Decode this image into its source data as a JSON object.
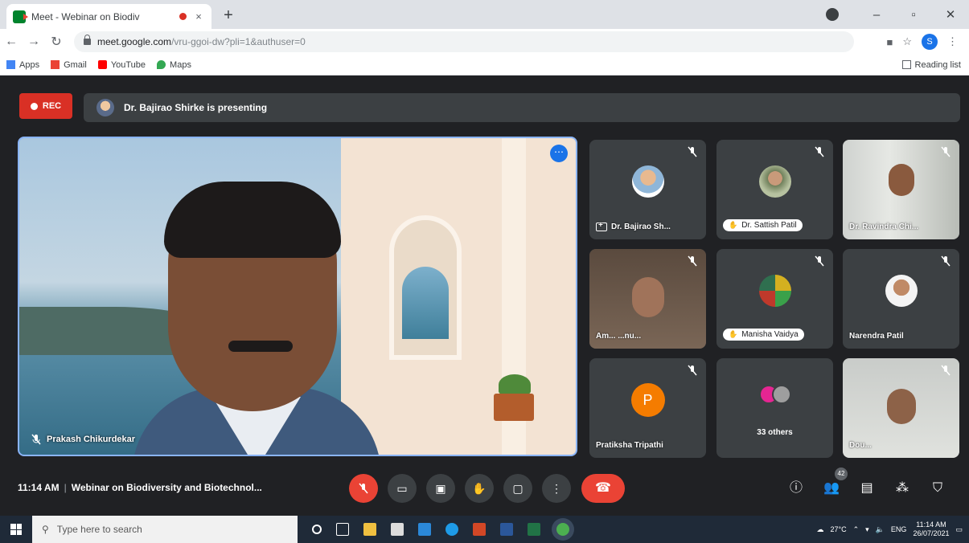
{
  "browser": {
    "tab_title": "Meet - Webinar on Biodiv",
    "tab_close": "×",
    "new_tab": "+",
    "win_minimize": "–",
    "win_maximize": "▫",
    "win_close": "✕",
    "url_host": "meet.google.com",
    "url_path": "/vru-ggoi-dw?pli=1&authuser=0",
    "profile_initial": "S",
    "bookmarks": [
      "Apps",
      "Gmail",
      "YouTube",
      "Maps"
    ],
    "reading_list": "Reading list",
    "colors": {
      "gmail": "#ea4335",
      "youtube": "#ff0000",
      "maps": "#34a853",
      "apps": "#4285f4"
    }
  },
  "meet": {
    "rec_label": "REC",
    "presenting_text": "Dr. Bajirao Shirke is presenting",
    "main_speaker_name": "Prakash Chikurdekar",
    "more_options": "⋯",
    "tiles": [
      {
        "name": "Dr. Bajirao Sh...",
        "type": "avatar"
      },
      {
        "name": "Dr. Sattish Patil",
        "type": "avatar-pill"
      },
      {
        "name": "Dr. Ravindra Chi...",
        "type": "camera"
      },
      {
        "name": "Am... ...nu...",
        "type": "camera"
      },
      {
        "name": "Manisha Vaidya",
        "type": "avatar-pill"
      },
      {
        "name": "Narendra Patil",
        "type": "avatar"
      },
      {
        "name": "Pratiksha Tripathi",
        "type": "letter",
        "letter": "P"
      },
      {
        "name": "33 others",
        "type": "others"
      },
      {
        "name": "Dou...",
        "type": "camera"
      }
    ],
    "time": "11:14 AM",
    "meeting_title": "Webinar on Biodiversity and Biotechnol...",
    "people_count": "42",
    "accent": "#8ab4f8",
    "end_color": "#ea4335"
  },
  "taskbar": {
    "search_placeholder": "Type here to search",
    "weather": "27°C",
    "language": "ENG",
    "clock_time": "11:14 AM",
    "clock_date": "26/07/2021"
  }
}
